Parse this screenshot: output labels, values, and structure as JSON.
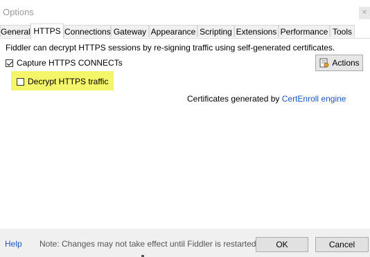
{
  "window": {
    "title": "Options"
  },
  "tabs": [
    {
      "label": "General"
    },
    {
      "label": "HTTPS"
    },
    {
      "label": "Connections"
    },
    {
      "label": "Gateway"
    },
    {
      "label": "Appearance"
    },
    {
      "label": "Scripting"
    },
    {
      "label": "Extensions"
    },
    {
      "label": "Performance"
    },
    {
      "label": "Tools"
    }
  ],
  "active_tab": "HTTPS",
  "https": {
    "description": "Fiddler can decrypt HTTPS sessions by re-signing traffic using self-generated certificates.",
    "capture_label": "Capture HTTPS CONNECTs",
    "capture_checked": true,
    "decrypt_label": "Decrypt HTTPS traffic",
    "decrypt_checked": false,
    "actions_label": "Actions",
    "certs_prefix": "Certificates generated by ",
    "certs_link": "CertEnroll engine"
  },
  "footer": {
    "help_label": "Help",
    "note": "Note: Changes may not take effect until Fiddler is restarted.",
    "ok_label": "OK",
    "cancel_label": "Cancel"
  },
  "colors": {
    "highlight": "#f5f56a",
    "link": "#1a55c2"
  }
}
